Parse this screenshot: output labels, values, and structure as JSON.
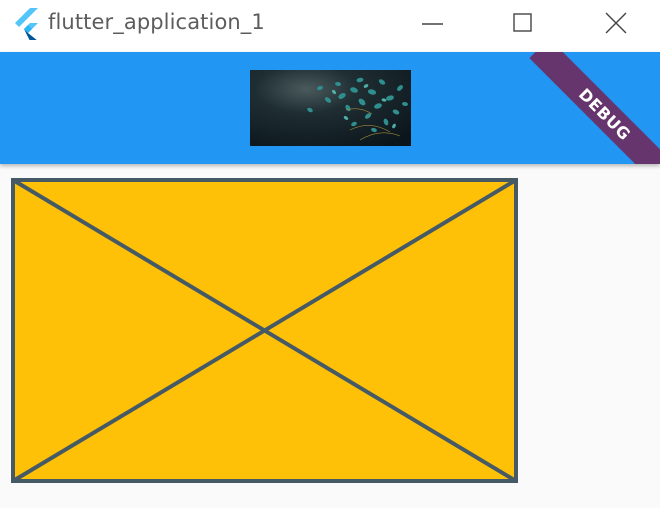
{
  "window": {
    "title": "flutter_application_1",
    "logo_icon": "flutter-logo-icon",
    "controls": {
      "minimize_icon": "minimize-icon",
      "maximize_icon": "maximize-icon",
      "close_icon": "close-icon"
    }
  },
  "appbar": {
    "background_color": "#2196f3",
    "title_image": "ginkgo-leaves-image"
  },
  "debug_banner": {
    "label": "DEBUG",
    "color": "#7f1440"
  },
  "body": {
    "placeholder": {
      "fill_color": "#ffc107",
      "stroke_color": "#455a64"
    },
    "background_color": "#fafafa"
  }
}
